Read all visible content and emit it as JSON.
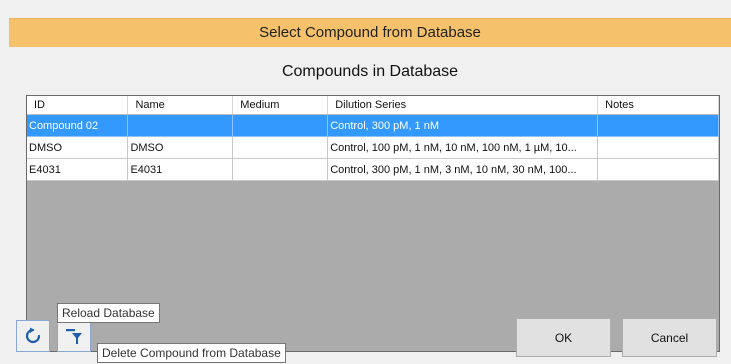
{
  "window": {
    "title": "Select Compound from Database"
  },
  "heading": "Compounds in Database",
  "grid": {
    "columns": [
      "ID",
      "Name",
      "Medium",
      "Dilution Series",
      "Notes"
    ],
    "rows": [
      {
        "id": "Compound 02",
        "name": "",
        "medium": "",
        "dilution": "Control, 300 pM, 1 nM",
        "notes": "",
        "selected": true
      },
      {
        "id": "DMSO",
        "name": "DMSO",
        "medium": "",
        "dilution": "Control, 100 pM, 1 nM, 10 nM, 100 nM, 1 µM, 10...",
        "notes": "",
        "selected": false
      },
      {
        "id": "E4031",
        "name": "E4031",
        "medium": "",
        "dilution": "Control, 300 pM, 1 nM, 3 nM, 10 nM, 30 nM, 100...",
        "notes": "",
        "selected": false
      }
    ]
  },
  "buttons": {
    "ok": "OK",
    "cancel": "Cancel"
  },
  "tooltips": {
    "reload": "Reload Database",
    "delete": "Delete Compound from Database"
  },
  "icons": {
    "reload": "reload-icon",
    "delete": "delete-filter-icon"
  },
  "colors": {
    "titlebar": "#f5c26b",
    "selection": "#3399ff"
  }
}
